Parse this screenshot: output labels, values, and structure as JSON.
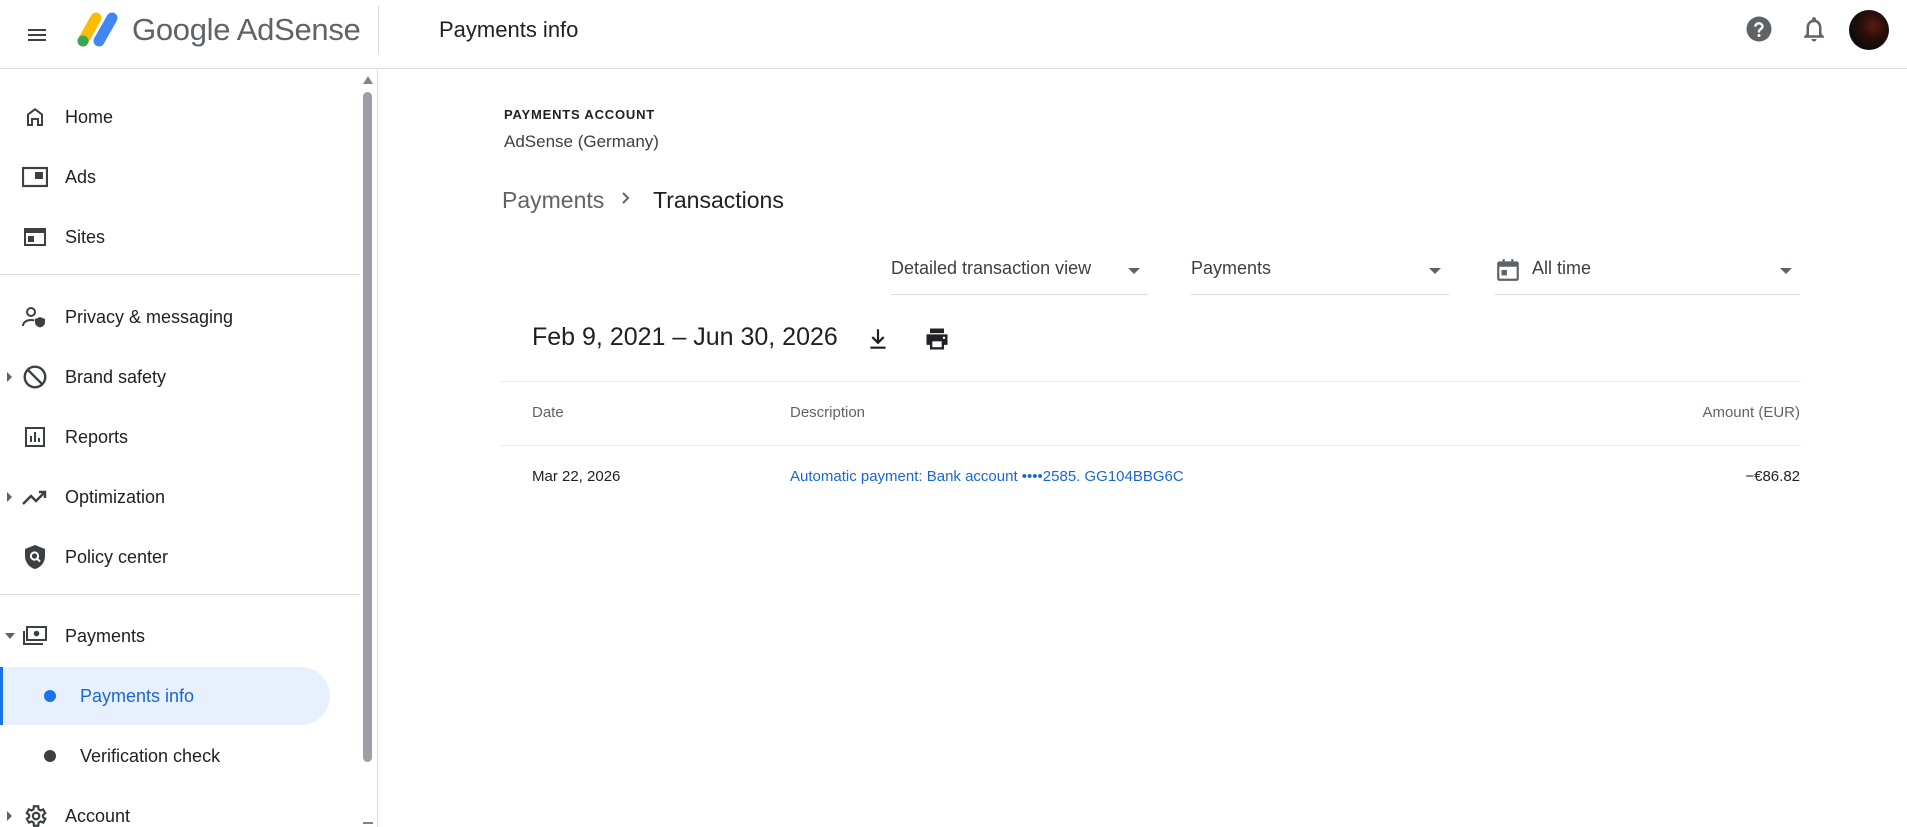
{
  "header": {
    "brand": "Google AdSense",
    "title": "Payments info"
  },
  "sidebar": {
    "items": [
      {
        "label": "Home",
        "icon": "home-icon"
      },
      {
        "label": "Ads",
        "icon": "ads-icon"
      },
      {
        "label": "Sites",
        "icon": "sites-icon"
      },
      {
        "label": "Privacy & messaging",
        "icon": "privacy-icon"
      },
      {
        "label": "Brand safety",
        "icon": "block-icon"
      },
      {
        "label": "Reports",
        "icon": "reports-icon"
      },
      {
        "label": "Optimization",
        "icon": "trending-icon"
      },
      {
        "label": "Policy center",
        "icon": "shield-search-icon"
      },
      {
        "label": "Payments",
        "icon": "payments-icon"
      },
      {
        "label": "Account",
        "icon": "gear-icon"
      }
    ],
    "payments_sub": [
      {
        "label": "Payments info",
        "active": true
      },
      {
        "label": "Verification check",
        "active": false
      }
    ]
  },
  "main": {
    "account_label": "PAYMENTS ACCOUNT",
    "account_name": "AdSense (Germany)",
    "breadcrumb": {
      "parent": "Payments",
      "current": "Transactions"
    },
    "filters": {
      "view": "Detailed transaction view",
      "type": "Payments",
      "date": "All time"
    },
    "range": "Feb 9, 2021 – Jun 30, 2026",
    "table": {
      "headers": {
        "date": "Date",
        "description": "Description",
        "amount": "Amount (EUR)"
      },
      "rows": [
        {
          "date": "Mar 22, 2026",
          "description": "Automatic payment: Bank account ••••2585. GG104BBG6C",
          "amount": "−€86.82"
        }
      ]
    }
  },
  "colors": {
    "accent": "#1a73e8",
    "active_bg": "#e8f0fe",
    "link": "#1967d2"
  }
}
